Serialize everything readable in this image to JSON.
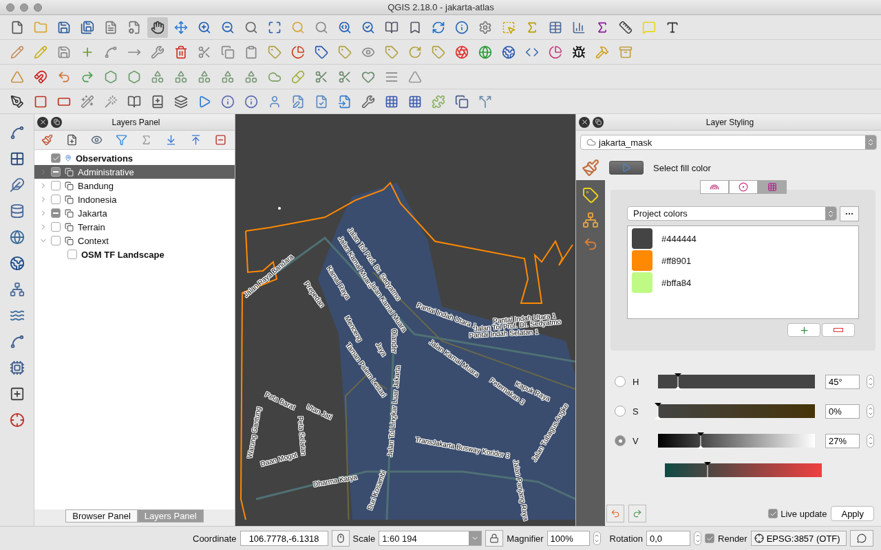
{
  "window": {
    "title": "QGIS 2.18.0 - jakarta-atlas"
  },
  "layers_panel": {
    "title": "Layers Panel",
    "layers": [
      {
        "name": "Observations",
        "kind": "layer",
        "checked": true,
        "partial": false,
        "selected": false
      },
      {
        "name": "Administrative",
        "kind": "group",
        "checked": false,
        "partial": true,
        "selected": true,
        "expanded": false
      },
      {
        "name": "Bandung",
        "kind": "group",
        "checked": false,
        "partial": false,
        "selected": false,
        "expanded": false
      },
      {
        "name": "Indonesia",
        "kind": "group",
        "checked": false,
        "partial": false,
        "selected": false,
        "expanded": false
      },
      {
        "name": "Jakarta",
        "kind": "group",
        "checked": false,
        "partial": true,
        "selected": false,
        "expanded": false
      },
      {
        "name": "Terrain",
        "kind": "group",
        "checked": false,
        "partial": false,
        "selected": false,
        "expanded": false
      },
      {
        "name": "Context",
        "kind": "group",
        "checked": false,
        "partial": false,
        "selected": false,
        "expanded": true,
        "children": [
          {
            "name": "OSM TF Landscape",
            "kind": "layer",
            "checked": false,
            "partial": false,
            "selected": false
          }
        ]
      }
    ]
  },
  "panel_tabs": [
    {
      "label": "Browser Panel",
      "selected": false
    },
    {
      "label": "Layers Panel",
      "selected": true
    }
  ],
  "map": {
    "labels": [
      "Jalan Raya Bandara",
      "Jalan Kamal Muara",
      "Jalan Tol Prof. Dr. Sedyatmo",
      "Kamal Raya",
      "Prepedan",
      "Jalan Kamal Muara",
      "Pantai Indah Utara 1",
      "Pantai Indah Utara 1",
      "Jalan Tol Prof. Dr. Sedyatmo",
      "Pantai Indah Selatan 1",
      "Menceng",
      "Olander",
      "Jaya",
      "Jalan Kamal Muara",
      "Taman Palem Lestari",
      "Peternakan 3",
      "Kapuk Raya",
      "Jalan Tol Lingkar Luar Jakarta",
      "Peta Barat",
      "Utan Jati",
      "Warung Gantung",
      "Peta Selatan",
      "Jalan Tubagus Angke",
      "TransJakarta Busway Koridor 3",
      "Daan Mogot",
      "Dharma Karya",
      "Duri Kosambi",
      "Jalan Panjang Raya"
    ]
  },
  "styling_panel": {
    "title": "Layer Styling",
    "layer": "jakarta_mask",
    "heading": "Select fill color",
    "color_tabs": [
      {
        "kind": "ramp",
        "selected": false
      },
      {
        "kind": "wheel",
        "selected": false
      },
      {
        "kind": "swatches",
        "selected": true
      }
    ],
    "palette": "Project colors",
    "colors": [
      {
        "label": "#444444",
        "color": "#444444"
      },
      {
        "label": "#ff8901",
        "color": "#ff8901"
      },
      {
        "label": "#bffa84",
        "color": "#bffa84"
      }
    ],
    "sliders": [
      {
        "label": "H",
        "kind": "hue",
        "selected": false,
        "level": 0.125,
        "value": "45°"
      },
      {
        "label": "S",
        "kind": "saturation",
        "selected": false,
        "level": 0,
        "value": "0%"
      },
      {
        "label": "V",
        "kind": "value",
        "selected": true,
        "level": 0.27,
        "value": "27%"
      }
    ],
    "cut_slider": {
      "level": 0.27
    },
    "live_update": {
      "label": "Live update",
      "checked": true
    },
    "apply": "Apply"
  },
  "status_bar": {
    "coordinate_label": "Coordinate",
    "coordinate": "106.7778,-6.1318",
    "scale_label": "Scale",
    "scale": "1:60 194",
    "magnifier_label": "Magnifier",
    "magnifier": "100%",
    "rotation_label": "Rotation",
    "rotation": "0,0",
    "render": {
      "label": "Render",
      "checked": true
    },
    "crs": "EPSG:3857 (OTF)"
  }
}
